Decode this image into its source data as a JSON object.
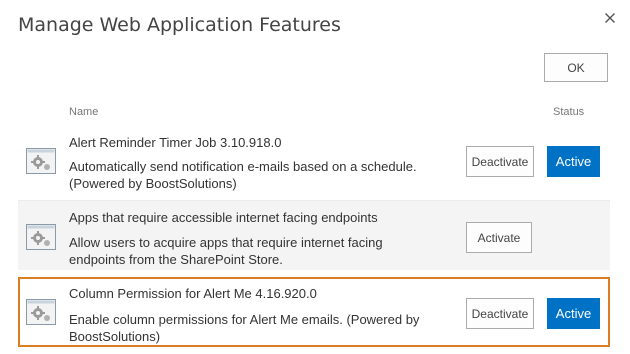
{
  "dialog": {
    "title": "Manage Web Application Features",
    "close_icon": "close-icon",
    "ok_label": "OK"
  },
  "table": {
    "name_header": "Name",
    "status_header": "Status"
  },
  "features": [
    {
      "title": "Alert Reminder Timer Job 3.10.918.0",
      "description": "Automatically send notification e-mails based on a schedule. (Powered by BoostSolutions)",
      "button_label": "Deactivate",
      "status": "Active",
      "icon": "feature-gear-icon"
    },
    {
      "title": "Apps that require accessible internet facing endpoints",
      "description": "Allow users to acquire apps that require internet facing endpoints from the SharePoint Store.",
      "button_label": "Activate",
      "status": "",
      "icon": "feature-gear-icon"
    },
    {
      "title": "Column Permission for Alert Me 4.16.920.0",
      "description": "Enable column permissions for Alert Me emails. (Powered by BoostSolutions)",
      "button_label": "Deactivate",
      "status": "Active",
      "icon": "feature-gear-icon"
    }
  ],
  "colors": {
    "active_badge": "#0072c6",
    "highlight_border": "#dc7d23",
    "row_shade": "#f4f4f4"
  }
}
